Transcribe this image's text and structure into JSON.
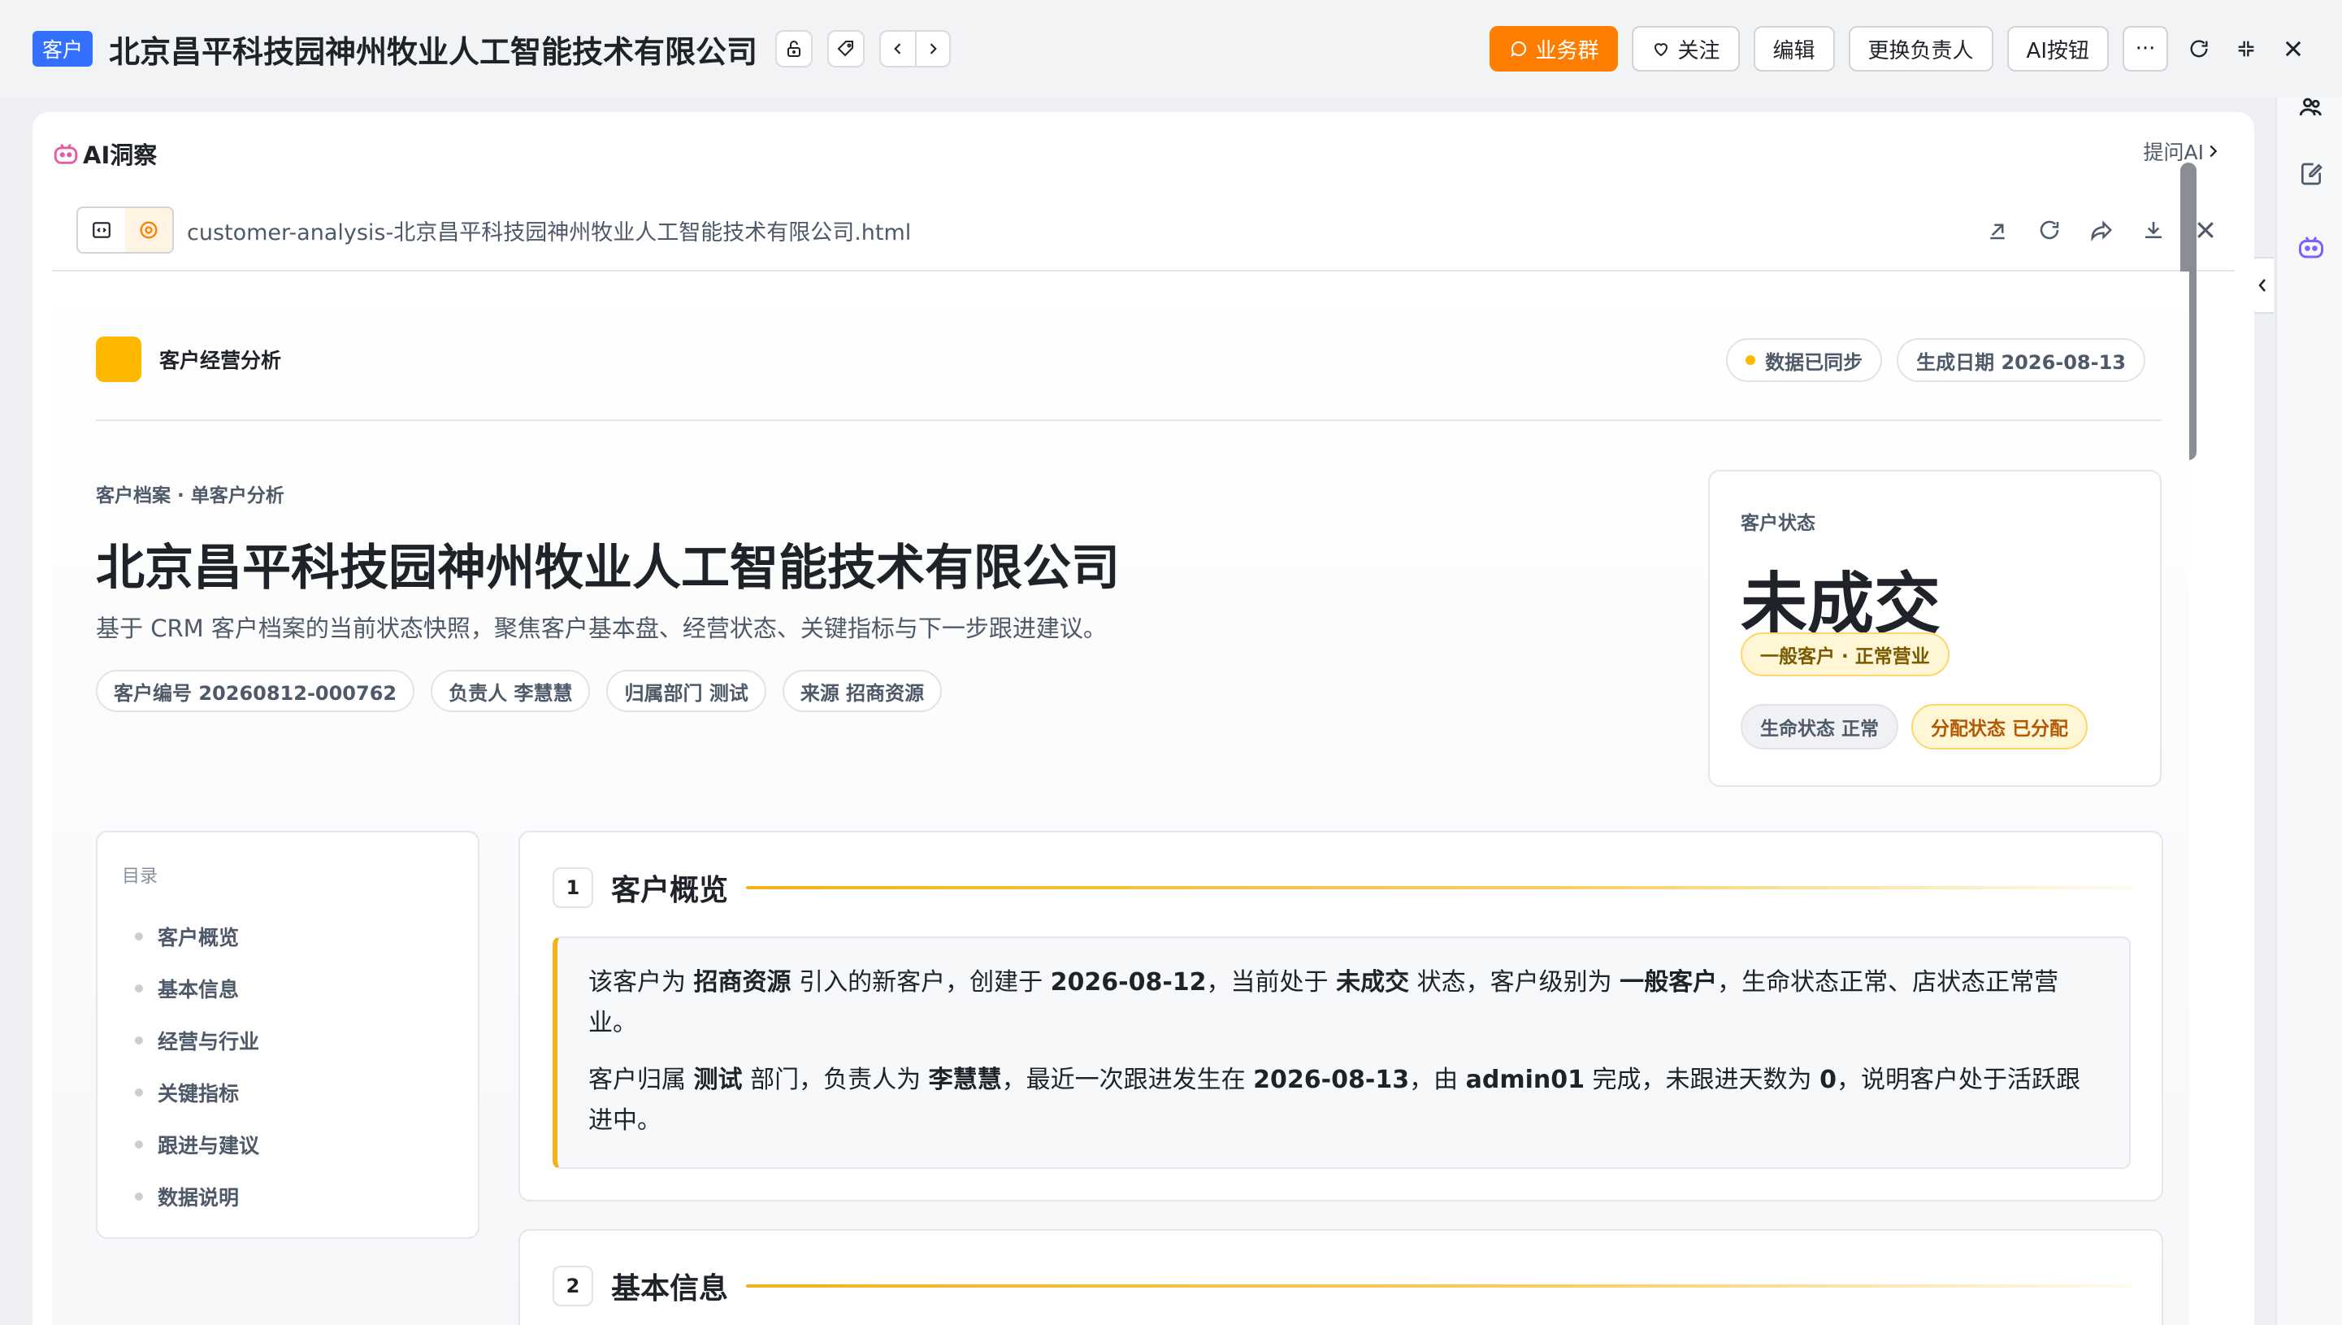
{
  "header": {
    "type_tag": "客户",
    "company_name": "北京昌平科技园神州牧业人工智能技术有限公司",
    "actions": {
      "business_group": "业务群",
      "follow": "关注",
      "edit": "编辑",
      "change_owner": "更换负责人",
      "ai_button": "AI按钮",
      "more": "···"
    }
  },
  "ai_panel": {
    "title": "AI洞察",
    "ask_ai": "提问AI",
    "file_name": "customer-analysis-北京昌平科技园神州牧业人工智能技术有限公司.html"
  },
  "report": {
    "header_title": "客户经营分析",
    "sync_status": "数据已同步",
    "generated_date": "生成日期 2026-08-13",
    "breadcrumb": "客户档案 · 单客户分析",
    "company_title": "北京昌平科技园神州牧业人工智能技术有限公司",
    "subtitle": "基于 CRM 客户档案的当前状态快照，聚焦客户基本盘、经营状态、关键指标与下一步跟进建议。",
    "meta_tags": [
      "客户编号 20260812-000762",
      "负责人 李慧慧",
      "归属部门 测试",
      "来源 招商资源"
    ],
    "status_card": {
      "label": "客户状态",
      "value": "未成交",
      "level_tag": "一般客户 · 正常营业",
      "life_status": "生命状态 正常",
      "assign_status": "分配状态 已分配"
    },
    "toc": {
      "label": "目录",
      "items": [
        "客户概览",
        "基本信息",
        "经营与行业",
        "关键指标",
        "跟进与建议",
        "数据说明"
      ]
    },
    "sections": [
      {
        "num": "1",
        "title": "客户概览",
        "p1": {
          "t1": "该客户为 ",
          "b1": "招商资源",
          "t2": " 引入的新客户，创建于 ",
          "b2": "2026-08-12",
          "t3": "，当前处于 ",
          "b3": "未成交",
          "t4": " 状态，客户级别为 ",
          "b4": "一般客户",
          "t5": "，生命状态正常、店状态正常营业。"
        },
        "p2": {
          "t1": "客户归属 ",
          "b1": "测试",
          "t2": " 部门，负责人为 ",
          "b2": "李慧慧",
          "t3": "，最近一次跟进发生在 ",
          "b3": "2026-08-13",
          "t4": "，由 ",
          "b4": "admin01",
          "t5": " 完成，未跟进天数为 ",
          "b5": "0",
          "t6": "，说明客户处于活跃跟进中。"
        }
      },
      {
        "num": "2",
        "title": "基本信息"
      }
    ]
  },
  "colors": {
    "accent_orange": "#ff7d00",
    "brand_gold": "#ffb800",
    "type_tag_blue": "#3370ff"
  }
}
